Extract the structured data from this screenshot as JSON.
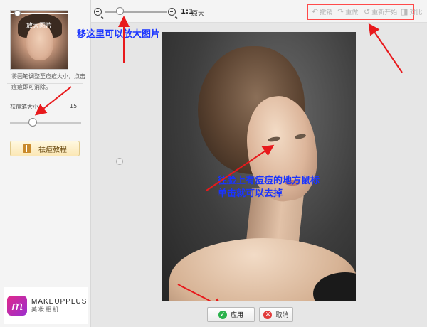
{
  "left_panel": {
    "thumbnail_label": "放大图片",
    "hint_text": "将画笔调整至痘痘大小，点击痘痘即可消除。",
    "brush_size_label": "祛痘笔大小",
    "brush_size_value": "15",
    "tutorial_button": "祛痘教程"
  },
  "logo": {
    "mark": "m",
    "name": "MAKEUPPLUS",
    "subtitle": "美妆相机",
    "brand_color": "#d8308c"
  },
  "toolbar": {
    "zoom_out_icon": "zoom-out-icon",
    "zoom_in_icon": "zoom-in-icon",
    "ratio": "1:1",
    "ratio_label": "原大",
    "undo_label": "撤销",
    "redo_label": "重做",
    "restart_label": "重新开始",
    "compare_label": "对比"
  },
  "annotations": {
    "zoom_note": "移这里可以放大图片",
    "face_note_line1": "往脸上有痘痘的地方鼠标",
    "face_note_line2": "单击就可以去掉",
    "annotation_color": "#1a34ff",
    "arrow_color": "#e8191c"
  },
  "bottom": {
    "apply_label": "应用",
    "cancel_label": "取消"
  }
}
